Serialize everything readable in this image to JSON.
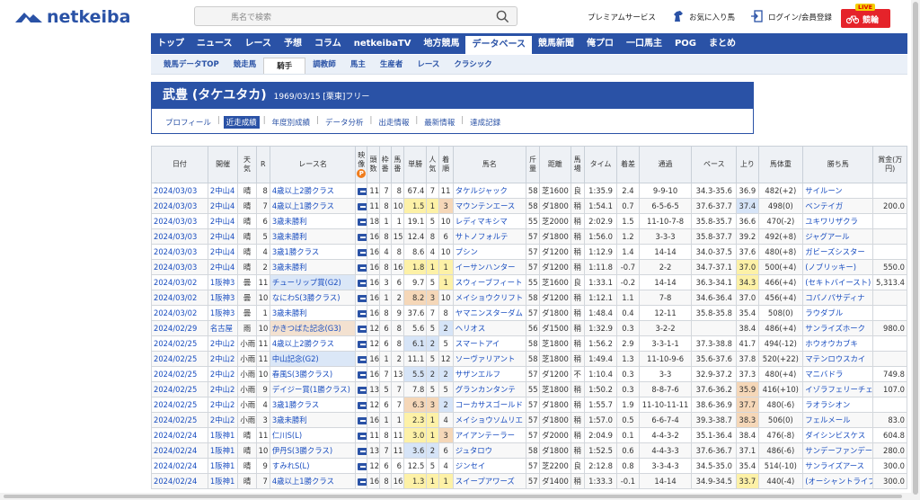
{
  "header": {
    "logo_text": "netkeiba",
    "search_placeholder": "馬名で検索",
    "premium": "プレミアムサービス",
    "favorite": "お気に入り馬",
    "login": "ログイン/会員登録",
    "live_badge": "LIVE",
    "live_label": "競輪"
  },
  "nav": {
    "items": [
      "トップ",
      "ニュース",
      "レース",
      "予想",
      "コラム",
      "netkeibaTV",
      "地方競馬",
      "データベース",
      "競馬新聞",
      "俺プロ",
      "一口馬主",
      "POG",
      "まとめ"
    ],
    "active_index": 7
  },
  "subnav": {
    "items": [
      "競馬データTOP",
      "競走馬",
      "騎手",
      "調教師",
      "馬主",
      "生産者",
      "レース",
      "クラシック"
    ],
    "active_index": 2
  },
  "jockey": {
    "name": "武豊 (タケユタカ)",
    "info": "1969/03/15 [栗東]フリー",
    "tabs": [
      "プロフィール",
      "近走成績",
      "年度別成績",
      "データ分析",
      "出走情報",
      "最新情報",
      "達成記録"
    ],
    "active_tab": 1
  },
  "table": {
    "headers": [
      "日付",
      "開催",
      "天気",
      "R",
      "レース名",
      "映像",
      "頭数",
      "枠番",
      "馬番",
      "単勝",
      "人気",
      "着順",
      "馬名",
      "斤量",
      "距離",
      "馬場",
      "タイム",
      "着差",
      "通過",
      "ペース",
      "上り",
      "馬体重",
      "勝ち馬",
      "賞金(万円)"
    ],
    "video_badge": "P",
    "rows": [
      [
        "2024/03/03",
        "2中山4",
        "晴",
        "8",
        "4歳以上2勝クラス",
        "",
        "11",
        "7",
        "8",
        "67.4",
        "7",
        "11",
        "タケルジャック",
        "58",
        "芝1600",
        "良",
        "1:35.9",
        "2.4",
        "9-9-10",
        "34.3-35.6",
        "36.9",
        "482(+2)",
        "サイルーン",
        ""
      ],
      [
        "2024/03/03",
        "2中山4",
        "晴",
        "7",
        "4歳以上1勝クラス",
        "",
        "11",
        "8",
        "10",
        "1.5",
        "1",
        "3",
        "マウンテンエース",
        "58",
        "ダ1800",
        "稍",
        "1:54.1",
        "0.7",
        "6-5-6-5",
        "37.6-37.7",
        "37.4",
        "498(0)",
        "ベンテイガ",
        "200.0"
      ],
      [
        "2024/03/03",
        "2中山4",
        "晴",
        "6",
        "3歳未勝利",
        "",
        "18",
        "1",
        "1",
        "19.1",
        "5",
        "10",
        "レディマキシマ",
        "55",
        "芝2000",
        "稍",
        "2:02.9",
        "1.5",
        "11-10-7-8",
        "35.8-35.7",
        "36.6",
        "470(-2)",
        "ユキワリザクラ",
        ""
      ],
      [
        "2024/03/03",
        "2中山4",
        "晴",
        "5",
        "3歳未勝利",
        "",
        "16",
        "8",
        "15",
        "12.4",
        "8",
        "6",
        "サトノフォルテ",
        "57",
        "ダ1800",
        "稍",
        "1:56.0",
        "1.2",
        "3-3-3",
        "35.8-37.7",
        "39.2",
        "492(+8)",
        "ジャグアール",
        ""
      ],
      [
        "2024/03/03",
        "2中山4",
        "晴",
        "4",
        "3歳1勝クラス",
        "",
        "16",
        "4",
        "8",
        "8.6",
        "4",
        "10",
        "プシン",
        "57",
        "ダ1200",
        "稍",
        "1:12.9",
        "1.4",
        "14-14",
        "34.0-37.5",
        "37.6",
        "480(+8)",
        "ガビーズシスター",
        ""
      ],
      [
        "2024/03/03",
        "2中山4",
        "晴",
        "2",
        "3歳未勝利",
        "",
        "16",
        "8",
        "16",
        "1.8",
        "1",
        "1",
        "イーサンハンター",
        "57",
        "ダ1200",
        "稍",
        "1:11.8",
        "-0.7",
        "2-2",
        "34.7-37.1",
        "37.0",
        "500(+4)",
        "(ノブリッキー)",
        "550.0"
      ],
      [
        "2024/03/02",
        "1阪神3",
        "曇",
        "11",
        "チューリップ賞(G2)",
        "",
        "16",
        "3",
        "6",
        "9.7",
        "5",
        "1",
        "スウィーブフィート",
        "55",
        "芝1600",
        "良",
        "1:33.1",
        "-0.2",
        "14-14",
        "36.3-34.1",
        "34.3",
        "466(+4)",
        "(セキトバイースト)",
        "5,313.4"
      ],
      [
        "2024/03/02",
        "1阪神3",
        "曇",
        "10",
        "なにわS(3勝クラス)",
        "",
        "16",
        "1",
        "2",
        "8.2",
        "3",
        "10",
        "メイショウクリフト",
        "58",
        "ダ1200",
        "稍",
        "1:12.1",
        "1.1",
        "7-8",
        "34.6-36.4",
        "37.0",
        "456(+4)",
        "コパノパサディナ",
        ""
      ],
      [
        "2024/03/02",
        "1阪神3",
        "曇",
        "1",
        "3歳未勝利",
        "",
        "16",
        "8",
        "9",
        "37.6",
        "7",
        "8",
        "ヤマニンスターダム",
        "57",
        "ダ1800",
        "稍",
        "1:48.4",
        "0.4",
        "12-11",
        "35.8-35.8",
        "35.4",
        "508(0)",
        "ラウダブル",
        ""
      ],
      [
        "2024/02/29",
        "名古屋",
        "雨",
        "10",
        "かきつばた記念(G3)",
        "",
        "12",
        "6",
        "8",
        "5.6",
        "5",
        "2",
        "ヘリオス",
        "56",
        "ダ1500",
        "稍",
        "1:32.9",
        "0.3",
        "3-2-2",
        "",
        "38.4",
        "486(+4)",
        "サンライズホーク",
        "980.0"
      ],
      [
        "2024/02/25",
        "2中山2",
        "小雨",
        "11",
        "4歳以上2勝クラス",
        "",
        "12",
        "6",
        "8",
        "6.1",
        "2",
        "5",
        "スマートアイ",
        "58",
        "芝1800",
        "稍",
        "1:56.2",
        "2.9",
        "3-3-1-1",
        "37.3-38.8",
        "41.7",
        "494(-12)",
        "ホウオウカブキ",
        ""
      ],
      [
        "2024/02/25",
        "2中山2",
        "小雨",
        "11",
        "中山記念(G2)",
        "",
        "16",
        "1",
        "2",
        "11.1",
        "5",
        "12",
        "ソーヴァリアント",
        "58",
        "芝1800",
        "稍",
        "1:49.4",
        "1.3",
        "11-10-9-6",
        "35.6-37.6",
        "37.8",
        "520(+22)",
        "マテンロウスカイ",
        ""
      ],
      [
        "2024/02/25",
        "2中山2",
        "小雨",
        "10",
        "春風S(3勝クラス)",
        "",
        "16",
        "7",
        "13",
        "5.5",
        "2",
        "2",
        "サザンエルフ",
        "57",
        "ダ1200",
        "不",
        "1:10.4",
        "0.3",
        "3-3",
        "32.9-37.2",
        "37.3",
        "480(+4)",
        "マニバドラ",
        "749.8"
      ],
      [
        "2024/02/25",
        "2中山2",
        "小雨",
        "9",
        "デイジー賞(1勝クラス)",
        "",
        "13",
        "5",
        "7",
        "7.8",
        "5",
        "5",
        "グランカンタンテ",
        "55",
        "芝1800",
        "稍",
        "1:50.2",
        "0.3",
        "8-8-7-6",
        "37.6-36.2",
        "35.9",
        "416(+10)",
        "イゾラフェリーチェ",
        "107.0"
      ],
      [
        "2024/02/25",
        "2中山2",
        "小雨",
        "4",
        "3歳1勝クラス",
        "",
        "12",
        "6",
        "7",
        "6.3",
        "3",
        "2",
        "コーカサスゴールド",
        "57",
        "ダ1800",
        "稍",
        "1:55.7",
        "1.9",
        "11-10-11-11",
        "38.6-36.9",
        "37.7",
        "480(-6)",
        "ラオラシオン",
        ""
      ],
      [
        "2024/02/25",
        "2中山2",
        "小雨",
        "3",
        "3歳未勝利",
        "",
        "16",
        "1",
        "1",
        "2.3",
        "1",
        "4",
        "メイショウソムリエ",
        "57",
        "ダ1800",
        "稍",
        "1:57.0",
        "0.5",
        "6-6-7-4",
        "39.3-38.7",
        "38.3",
        "506(0)",
        "フェルメール",
        "83.0"
      ],
      [
        "2024/02/24",
        "1阪神1",
        "晴",
        "11",
        "仁川S(L)",
        "",
        "11",
        "8",
        "11",
        "3.0",
        "1",
        "3",
        "アイアンテーラー",
        "57",
        "ダ2000",
        "稍",
        "2:04.9",
        "0.1",
        "4-4-3-2",
        "35.1-36.4",
        "38.4",
        "476(-8)",
        "ダイシンビスケス",
        "604.8"
      ],
      [
        "2024/02/24",
        "1阪神1",
        "晴",
        "10",
        "伊丹S(3勝クラス)",
        "",
        "13",
        "7",
        "11",
        "3.6",
        "2",
        "6",
        "ジュタロウ",
        "58",
        "ダ1800",
        "稍",
        "1:52.5",
        "0.6",
        "4-4-3-3",
        "37.6-36.7",
        "37.1",
        "486(-6)",
        "サンデーファンデー",
        "280.0"
      ],
      [
        "2024/02/24",
        "1阪神1",
        "晴",
        "9",
        "すみれS(L)",
        "",
        "12",
        "6",
        "6",
        "12.5",
        "5",
        "4",
        "ジンセイ",
        "57",
        "芝2200",
        "良",
        "2:12.8",
        "0.8",
        "3-3-4-3",
        "34.5-35.0",
        "35.4",
        "514(-10)",
        "サンライズアース",
        "300.0"
      ],
      [
        "2024/02/24",
        "1阪神1",
        "晴",
        "7",
        "4歳以上1勝クラス",
        "",
        "16",
        "8",
        "16",
        "1.3",
        "1",
        "1",
        "スイープアワーズ",
        "57",
        "ダ1400",
        "稍",
        "1:33.3",
        "-0.1",
        "14-14",
        "34.9-34.5",
        "33.7",
        "440(-4)",
        "(オーシャントライブ)",
        "300.0"
      ]
    ]
  },
  "colors": {
    "brand": "#2a52a6",
    "live_red": "#e5232a",
    "fav1_yellow": "#fdf1a7",
    "fav2_blue": "#d6e4f7",
    "fav3_orange": "#f5d7b8"
  }
}
